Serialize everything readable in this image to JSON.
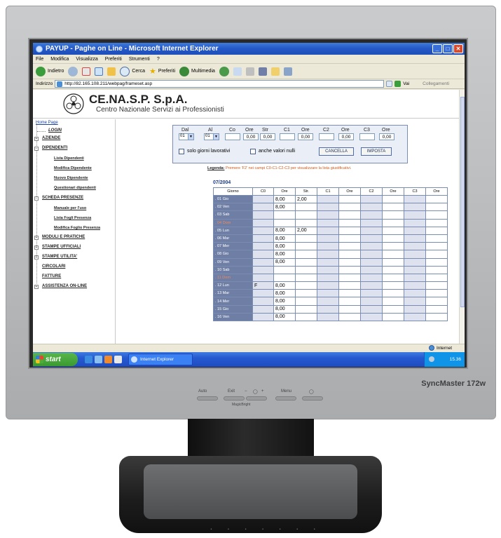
{
  "window": {
    "title": "PAYUP - Paghe on Line - Microsoft Internet Explorer"
  },
  "menu": [
    "File",
    "Modifica",
    "Visualizza",
    "Preferiti",
    "Strumenti",
    "?"
  ],
  "toolbar": {
    "back": "Indietro",
    "search": "Cerca",
    "favorites": "Preferiti",
    "multimedia": "Multimedia"
  },
  "address": {
    "label": "Indirizzo",
    "url": "http://82.165.108.211/webpag/frameset.asp",
    "go": "Vai",
    "links": "Collegamenti"
  },
  "company": {
    "name": "CE.NA.S.P. S.p.A.",
    "subtitle": "Centro Nazionale Servizi ai Professionisti"
  },
  "sidebar": {
    "items": [
      {
        "label": "Home Page",
        "kind": "top"
      },
      {
        "label": "LOGIN",
        "kind": "sub-italic"
      },
      {
        "label": "AZIENDE",
        "kind": "sec",
        "expander": "+"
      },
      {
        "label": "DIPENDENTI",
        "kind": "sec",
        "expander": "−"
      },
      {
        "label": "Lista Dipendenti",
        "kind": "sub"
      },
      {
        "label": "Modifica Dipendente",
        "kind": "sub"
      },
      {
        "label": "Nuovo Dipendente",
        "kind": "sub"
      },
      {
        "label": "Questionari dipendenti",
        "kind": "sub"
      },
      {
        "label": "SCHEDA PRESENZE",
        "kind": "sec",
        "expander": "−"
      },
      {
        "label": "Manuale per l'uso",
        "kind": "sub"
      },
      {
        "label": "Lista Fogli Presenza",
        "kind": "sub"
      },
      {
        "label": "Modifica Foglio Presenza",
        "kind": "sub"
      },
      {
        "label": "MODULI E PRATICHE",
        "kind": "sec",
        "expander": "+"
      },
      {
        "label": "STAMPE UFFICIALI",
        "kind": "sec",
        "expander": "+"
      },
      {
        "label": "STAMPE UTILITA'",
        "kind": "sec",
        "expander": "+"
      },
      {
        "label": "CIRCOLARI",
        "kind": "sec"
      },
      {
        "label": "FATTURE",
        "kind": "sec"
      },
      {
        "label": "ASSISTENZA ON-LINE",
        "kind": "sec",
        "expander": "+"
      }
    ]
  },
  "filter": {
    "labels": {
      "dal": "Dal",
      "al": "Al",
      "co": "Co",
      "ore1": "Ore",
      "str": "Str",
      "c1": "C1",
      "ore2": "Ore",
      "c2": "C2",
      "ore3": "Ore",
      "c3": "C3",
      "ore4": "Ore"
    },
    "values": {
      "dal": "01",
      "al": "01",
      "co": "",
      "ore1": "0,00",
      "str": "0,00",
      "c1": "",
      "ore2": "0,00",
      "c2": "",
      "ore3": "0,00",
      "c3": "",
      "ore4": "0,00"
    },
    "checkboxes": {
      "solo_giorni": "solo giorni lavorativi",
      "anche_valori": "anche valori nulli"
    },
    "buttons": {
      "cancella": "CANCELLA",
      "imposta": "IMPOSTA"
    }
  },
  "legend": {
    "key": "Legenda:",
    "text": "Premere 'F2' nei campi C0-C1-C2-C3 per visualizzare la lista giustificativi."
  },
  "month": "07/2004",
  "table": {
    "headers": [
      "Giorno",
      "C0",
      "Ore",
      "Str.",
      "C1",
      "Ore",
      "C2",
      "Ore",
      "C3",
      "Ore"
    ],
    "rows": [
      {
        "day": ". 01 Gio",
        "sunday": false,
        "c0": "",
        "ore": "8,00",
        "str": "2,00"
      },
      {
        "day": ". 02 Ven",
        "sunday": false,
        "c0": "",
        "ore": "8,00",
        "str": ""
      },
      {
        "day": ". 03 Sab",
        "sunday": false,
        "c0": "",
        "ore": "",
        "str": ""
      },
      {
        "day": ". 04 Dom",
        "sunday": true,
        "c0": "",
        "ore": "",
        "str": ""
      },
      {
        "day": ". 05 Lun",
        "sunday": false,
        "c0": "",
        "ore": "8,00",
        "str": "2,00"
      },
      {
        "day": ". 06 Mar",
        "sunday": false,
        "c0": "",
        "ore": "8,00",
        "str": ""
      },
      {
        "day": ". 07 Mer",
        "sunday": false,
        "c0": "",
        "ore": "8,00",
        "str": ""
      },
      {
        "day": ". 08 Gio",
        "sunday": false,
        "c0": "",
        "ore": "8,00",
        "str": ""
      },
      {
        "day": ". 09 Ven",
        "sunday": false,
        "c0": "",
        "ore": "8,00",
        "str": ""
      },
      {
        "day": ". 10 Sab",
        "sunday": false,
        "c0": "",
        "ore": "",
        "str": ""
      },
      {
        "day": ". 11 Dom",
        "sunday": true,
        "c0": "",
        "ore": "",
        "str": ""
      },
      {
        "day": ". 12 Lun",
        "sunday": false,
        "c0": "F",
        "ore": "8,00",
        "str": ""
      },
      {
        "day": ". 13 Mar",
        "sunday": false,
        "c0": "",
        "ore": "8,00",
        "str": ""
      },
      {
        "day": ". 14 Mer",
        "sunday": false,
        "c0": "",
        "ore": "8,00",
        "str": ""
      },
      {
        "day": ". 15 Gio",
        "sunday": false,
        "c0": "",
        "ore": "8,00",
        "str": ""
      },
      {
        "day": ". 16 Ven",
        "sunday": false,
        "c0": "",
        "ore": "8,00",
        "str": ""
      }
    ]
  },
  "status": {
    "zone": "Internet"
  },
  "taskbar": {
    "start": "start",
    "task": "Internet Explorer",
    "clock": "15.36"
  },
  "monitor": {
    "brand": "SyncMaster 172w",
    "controls": [
      "Auto",
      "Exit",
      "−",
      "◯",
      "+",
      "Menu",
      "◯"
    ],
    "controls_sub": "MagicBright"
  },
  "colors": {
    "xp_blue": "#2458c8",
    "day_col": "#6f7ea5",
    "sunday_text": "#f08a5a",
    "legend": "#d05a1a"
  }
}
